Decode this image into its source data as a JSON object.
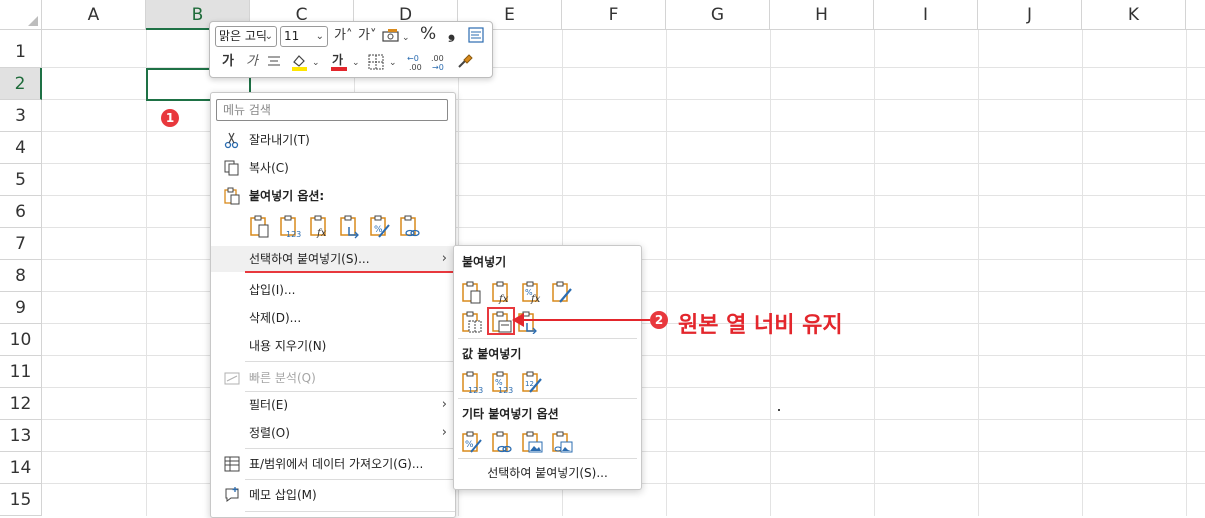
{
  "sheet": {
    "columns": [
      "A",
      "B",
      "C",
      "D",
      "E",
      "F",
      "G",
      "H",
      "I",
      "J",
      "K"
    ],
    "rows": [
      "1",
      "2",
      "3",
      "4",
      "5",
      "6",
      "7",
      "8",
      "9",
      "10",
      "11",
      "12",
      "13",
      "14",
      "15"
    ],
    "selected_column": "B",
    "selected_row": "2"
  },
  "mini_toolbar": {
    "font_name": "맑은 고딕",
    "font_size": "11",
    "grow_font": "가˄",
    "shrink_font": "가˅",
    "percent": "%",
    "comma": "❟",
    "bold": "가",
    "italic": "가",
    "font_color_glyph": "가"
  },
  "context_menu": {
    "search_placeholder": "메뉴 검색",
    "cut": "잘라내기(T)",
    "copy": "복사(C)",
    "paste_options": "붙여넣기 옵션:",
    "paste_special": "선택하여 붙여넣기(S)...",
    "insert": "삽입(I)...",
    "delete": "삭제(D)...",
    "clear_contents": "내용 지우기(N)",
    "quick_analysis": "빠른 분석(Q)",
    "filter": "필터(E)",
    "sort": "정렬(O)",
    "get_data": "표/범위에서 데이터 가져오기(G)...",
    "insert_comment": "메모 삽입(M)"
  },
  "submenu": {
    "paste_header": "붙여넣기",
    "values_header": "값 붙여넣기",
    "other_header": "기타 붙여넣기 옵션",
    "paste_special": "선택하여 붙여넣기(S)..."
  },
  "annotations": {
    "badge1": "1",
    "badge2": "2",
    "callout_text": "원본 열 너비 유지"
  },
  "colors": {
    "accent_green": "#1e7145",
    "annotation_red": "#e3262c",
    "icon_orange": "#d98a1c",
    "icon_blue": "#2b6cb0"
  }
}
